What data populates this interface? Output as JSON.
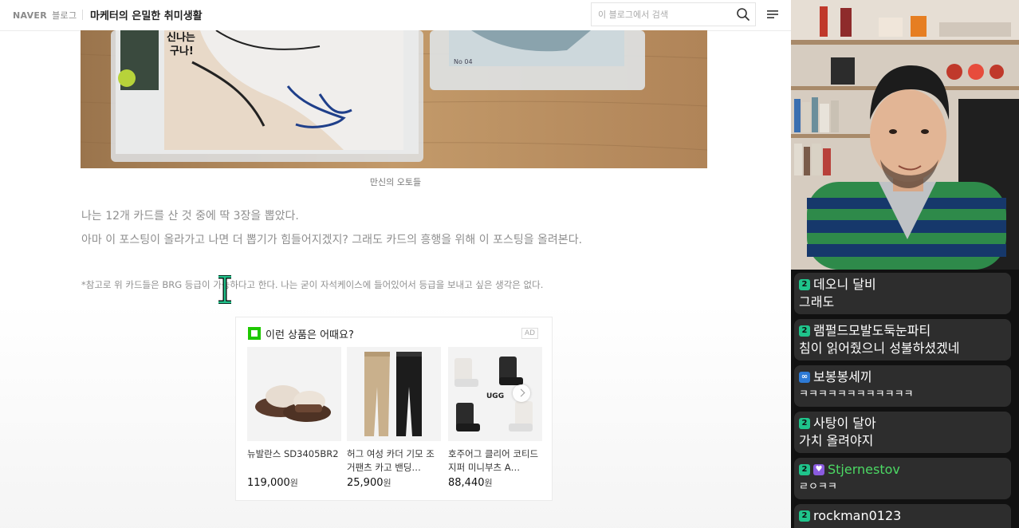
{
  "header": {
    "brand": "NAVER",
    "brand_sub": "블로그",
    "blog_name": "마케터의 은밀한 취미생활",
    "search_placeholder": "이 블로그에서 검색"
  },
  "photo": {
    "caption": "만신의 오토들",
    "comic_text_line1": "신나는",
    "comic_text_line2": "구나!",
    "card_label": "No 04"
  },
  "content": {
    "paragraph1": "나는 12개 카드를 산 것 중에 딱 3장을 뽑았다.",
    "paragraph2": "아마 이 포스팅이 올라가고 나면 더 뽑기가 힘들어지겠지? 그래도 카드의 흥행을 위해 이 포스팅을 올려본다.",
    "note": "*참고로 위 카드들은 BRG 등급이 가능하다고 한다. 나는 굳이 자석케이스에 들어있어서 등급을 보내고 싶은 생각은 없다."
  },
  "ad": {
    "title": "이런 상품은 어때요?",
    "badge": "AD",
    "products": [
      {
        "name": "뉴발란스 SD3405BR2",
        "price": "119,000",
        "unit": "원"
      },
      {
        "name": "허그 여성 카더 기모 조거팬츠 카고 밴딩…",
        "price": "25,900",
        "unit": "원"
      },
      {
        "name": "호주어그 클리어 코티드 지퍼 미니부츠 A…",
        "price": "88,440",
        "unit": "원",
        "brand_mark": "UGG"
      }
    ]
  },
  "chat": {
    "messages": [
      {
        "user": "데오니 달비",
        "text": "그래도",
        "badge": "2"
      },
      {
        "user": "램펄드모발도둑눈파티",
        "text": "침이 읽어줬으니 성불하셨겠네",
        "badge": "2"
      },
      {
        "user": "보봉봉세끼",
        "text": "ㅋㅋㅋㅋㅋㅋㅋㅋㅋㅋㅋㅋ",
        "badge": "∞"
      },
      {
        "user": "사탕이 달아",
        "text": "가치 올려야지",
        "badge": "2"
      },
      {
        "user": "Stjernestov",
        "text": "ㄹㅇㅋㅋ",
        "badge": "2",
        "user_color": "#4cd964",
        "extra_badge": "♥"
      },
      {
        "user": "rockman0123",
        "text": "",
        "badge": "2"
      }
    ]
  }
}
